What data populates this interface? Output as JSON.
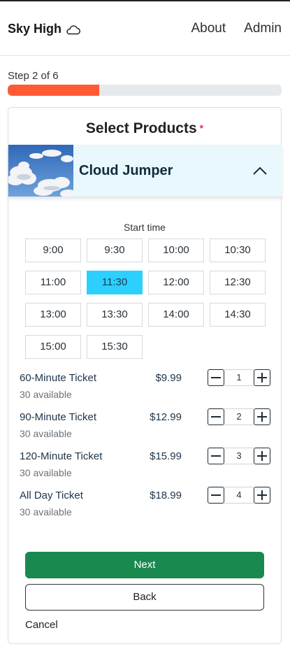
{
  "header": {
    "brand": "Sky High",
    "brand_icon": "cloud-icon",
    "nav": {
      "about": "About",
      "admin": "Admin"
    }
  },
  "progress": {
    "label": "Step 2 of 6",
    "fraction": 0.333,
    "color": "#ff5a36"
  },
  "form": {
    "title": "Select Products",
    "required_mark": "*",
    "product": {
      "name": "Cloud Jumper",
      "expanded": true,
      "image": "cloud-sky-photo"
    },
    "start_time_label": "Start time",
    "times": [
      "9:00",
      "9:30",
      "10:00",
      "10:30",
      "11:00",
      "11:30",
      "12:00",
      "12:30",
      "13:00",
      "13:30",
      "14:00",
      "14:30",
      "15:00",
      "15:30"
    ],
    "selected_time": "11:30",
    "tickets": [
      {
        "name": "60-Minute Ticket",
        "price": "$9.99",
        "available": "30 available",
        "qty": "1"
      },
      {
        "name": "90-Minute Ticket",
        "price": "$12.99",
        "available": "30 available",
        "qty": "2"
      },
      {
        "name": "120-Minute Ticket",
        "price": "$15.99",
        "available": "30 available",
        "qty": "3"
      },
      {
        "name": "All Day Ticket",
        "price": "$18.99",
        "available": "30 available",
        "qty": "4"
      }
    ],
    "next_label": "Next",
    "back_label": "Back",
    "cancel_label": "Cancel"
  },
  "colors": {
    "accent_selected": "#2bd0ff",
    "primary": "#1a8950",
    "product_bg": "#e8f8fd"
  }
}
